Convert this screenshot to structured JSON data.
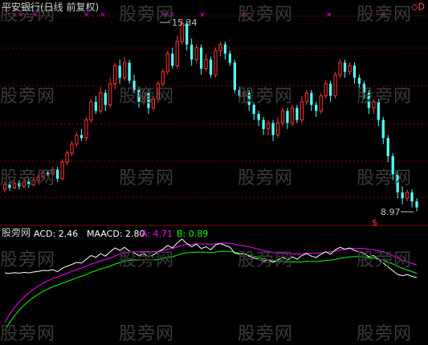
{
  "title": "平安银行(日线 前复权)",
  "top_right_markers": "◇D",
  "price_high_label": "15.34",
  "price_low_label": "8.97",
  "dollar_marker": "$",
  "indicator": {
    "name": "股旁网",
    "acd": "ACD: 2.46",
    "maacd": "MAACD: 2.80",
    "a": "A: 4.71",
    "b": "B: 0.89"
  },
  "watermark_text": "股旁网",
  "colors": {
    "bg": "#000000",
    "up": "#ff3232",
    "down": "#54ffff",
    "grid": "#8b0000",
    "text": "#c0c0c0",
    "title": "#d0d0d0",
    "line_white": "#ffffff",
    "line_magenta": "#ff00ff",
    "line_green": "#00ff00",
    "marker": "#ff00ff"
  },
  "chart_data": {
    "type": "candlestick",
    "price_range": [
      8.9,
      15.34
    ],
    "high": 15.34,
    "low": 8.97,
    "candles": [
      {
        "o": 9.7,
        "c": 9.85,
        "h": 9.95,
        "l": 9.6
      },
      {
        "o": 9.85,
        "c": 9.75,
        "h": 9.95,
        "l": 9.65
      },
      {
        "o": 9.75,
        "c": 9.9,
        "h": 10.0,
        "l": 9.7
      },
      {
        "o": 9.9,
        "c": 9.8,
        "h": 10.0,
        "l": 9.7
      },
      {
        "o": 9.8,
        "c": 9.95,
        "h": 10.05,
        "l": 9.75
      },
      {
        "o": 9.95,
        "c": 9.85,
        "h": 10.05,
        "l": 9.75
      },
      {
        "o": 9.85,
        "c": 10.0,
        "h": 10.1,
        "l": 9.8
      },
      {
        "o": 10.0,
        "c": 10.1,
        "h": 10.2,
        "l": 9.9
      },
      {
        "o": 10.1,
        "c": 10.25,
        "h": 10.35,
        "l": 10.0
      },
      {
        "o": 10.25,
        "c": 10.2,
        "h": 10.35,
        "l": 10.1
      },
      {
        "o": 10.2,
        "c": 10.35,
        "h": 10.45,
        "l": 10.15
      },
      {
        "o": 10.35,
        "c": 10.05,
        "h": 10.45,
        "l": 9.95
      },
      {
        "o": 10.05,
        "c": 10.6,
        "h": 10.7,
        "l": 10.0
      },
      {
        "o": 10.6,
        "c": 10.9,
        "h": 11.0,
        "l": 10.5
      },
      {
        "o": 10.9,
        "c": 11.2,
        "h": 11.3,
        "l": 10.8
      },
      {
        "o": 11.2,
        "c": 11.5,
        "h": 11.6,
        "l": 11.1
      },
      {
        "o": 11.5,
        "c": 11.4,
        "h": 11.7,
        "l": 11.3
      },
      {
        "o": 11.4,
        "c": 12.0,
        "h": 12.1,
        "l": 11.3
      },
      {
        "o": 12.0,
        "c": 12.6,
        "h": 12.7,
        "l": 11.9
      },
      {
        "o": 12.6,
        "c": 12.3,
        "h": 12.8,
        "l": 12.2
      },
      {
        "o": 12.3,
        "c": 12.9,
        "h": 13.1,
        "l": 12.2
      },
      {
        "o": 12.9,
        "c": 12.5,
        "h": 13.0,
        "l": 12.3
      },
      {
        "o": 12.5,
        "c": 13.2,
        "h": 13.4,
        "l": 12.4
      },
      {
        "o": 13.2,
        "c": 13.8,
        "h": 13.9,
        "l": 13.0
      },
      {
        "o": 13.8,
        "c": 13.4,
        "h": 14.0,
        "l": 13.2
      },
      {
        "o": 13.4,
        "c": 13.9,
        "h": 14.1,
        "l": 13.3
      },
      {
        "o": 13.9,
        "c": 13.3,
        "h": 14.0,
        "l": 13.2
      },
      {
        "o": 13.3,
        "c": 13.0,
        "h": 13.5,
        "l": 12.9
      },
      {
        "o": 13.0,
        "c": 12.6,
        "h": 13.1,
        "l": 12.4
      },
      {
        "o": 12.6,
        "c": 12.9,
        "h": 13.0,
        "l": 12.5
      },
      {
        "o": 12.9,
        "c": 12.4,
        "h": 13.0,
        "l": 12.2
      },
      {
        "o": 12.4,
        "c": 12.7,
        "h": 12.8,
        "l": 12.3
      },
      {
        "o": 12.7,
        "c": 13.2,
        "h": 13.3,
        "l": 12.6
      },
      {
        "o": 13.2,
        "c": 13.6,
        "h": 13.7,
        "l": 13.1
      },
      {
        "o": 13.6,
        "c": 14.2,
        "h": 14.3,
        "l": 13.5
      },
      {
        "o": 14.2,
        "c": 13.8,
        "h": 14.4,
        "l": 13.7
      },
      {
        "o": 13.8,
        "c": 14.6,
        "h": 14.8,
        "l": 13.7
      },
      {
        "o": 14.6,
        "c": 15.2,
        "h": 15.34,
        "l": 14.5
      },
      {
        "o": 15.2,
        "c": 14.5,
        "h": 15.3,
        "l": 14.3
      },
      {
        "o": 14.5,
        "c": 14.0,
        "h": 14.7,
        "l": 13.8
      },
      {
        "o": 14.0,
        "c": 14.4,
        "h": 14.5,
        "l": 13.9
      },
      {
        "o": 14.4,
        "c": 13.7,
        "h": 14.5,
        "l": 13.5
      },
      {
        "o": 13.7,
        "c": 14.0,
        "h": 14.2,
        "l": 13.6
      },
      {
        "o": 14.0,
        "c": 13.5,
        "h": 14.1,
        "l": 13.4
      },
      {
        "o": 13.5,
        "c": 14.3,
        "h": 14.4,
        "l": 13.4
      },
      {
        "o": 14.3,
        "c": 14.5,
        "h": 14.6,
        "l": 14.1
      },
      {
        "o": 14.5,
        "c": 14.2,
        "h": 14.6,
        "l": 14.0
      },
      {
        "o": 14.2,
        "c": 13.9,
        "h": 14.3,
        "l": 13.8
      },
      {
        "o": 13.9,
        "c": 13.0,
        "h": 14.0,
        "l": 12.9
      },
      {
        "o": 13.0,
        "c": 12.8,
        "h": 13.1,
        "l": 12.6
      },
      {
        "o": 12.8,
        "c": 12.9,
        "h": 13.0,
        "l": 12.6
      },
      {
        "o": 12.9,
        "c": 12.5,
        "h": 13.0,
        "l": 12.3
      },
      {
        "o": 12.5,
        "c": 12.2,
        "h": 12.6,
        "l": 12.0
      },
      {
        "o": 12.2,
        "c": 12.0,
        "h": 12.3,
        "l": 11.8
      },
      {
        "o": 12.0,
        "c": 11.7,
        "h": 12.1,
        "l": 11.5
      },
      {
        "o": 11.7,
        "c": 11.9,
        "h": 12.0,
        "l": 11.5
      },
      {
        "o": 11.9,
        "c": 11.5,
        "h": 12.0,
        "l": 11.3
      },
      {
        "o": 11.5,
        "c": 11.9,
        "h": 12.1,
        "l": 11.4
      },
      {
        "o": 11.9,
        "c": 12.3,
        "h": 12.4,
        "l": 11.8
      },
      {
        "o": 12.3,
        "c": 11.9,
        "h": 12.4,
        "l": 11.7
      },
      {
        "o": 11.9,
        "c": 12.4,
        "h": 12.5,
        "l": 11.8
      },
      {
        "o": 12.4,
        "c": 12.0,
        "h": 12.5,
        "l": 11.9
      },
      {
        "o": 12.0,
        "c": 12.6,
        "h": 12.8,
        "l": 11.9
      },
      {
        "o": 12.6,
        "c": 12.9,
        "h": 13.0,
        "l": 12.5
      },
      {
        "o": 12.9,
        "c": 12.5,
        "h": 13.0,
        "l": 12.3
      },
      {
        "o": 12.5,
        "c": 12.3,
        "h": 12.6,
        "l": 12.1
      },
      {
        "o": 12.3,
        "c": 12.8,
        "h": 12.9,
        "l": 12.2
      },
      {
        "o": 12.8,
        "c": 13.2,
        "h": 13.3,
        "l": 12.7
      },
      {
        "o": 13.2,
        "c": 12.8,
        "h": 13.3,
        "l": 12.6
      },
      {
        "o": 12.8,
        "c": 13.5,
        "h": 13.6,
        "l": 12.7
      },
      {
        "o": 13.5,
        "c": 13.9,
        "h": 14.0,
        "l": 13.4
      },
      {
        "o": 13.9,
        "c": 13.6,
        "h": 14.0,
        "l": 13.4
      },
      {
        "o": 13.6,
        "c": 13.8,
        "h": 13.9,
        "l": 13.5
      },
      {
        "o": 13.8,
        "c": 13.4,
        "h": 13.9,
        "l": 13.2
      },
      {
        "o": 13.4,
        "c": 13.2,
        "h": 13.5,
        "l": 13.0
      },
      {
        "o": 13.2,
        "c": 12.9,
        "h": 13.3,
        "l": 12.7
      },
      {
        "o": 12.9,
        "c": 12.4,
        "h": 13.0,
        "l": 12.2
      },
      {
        "o": 12.4,
        "c": 12.6,
        "h": 12.7,
        "l": 12.2
      },
      {
        "o": 12.6,
        "c": 12.0,
        "h": 12.7,
        "l": 11.8
      },
      {
        "o": 12.0,
        "c": 11.4,
        "h": 12.1,
        "l": 11.2
      },
      {
        "o": 11.4,
        "c": 10.8,
        "h": 11.5,
        "l": 10.6
      },
      {
        "o": 10.8,
        "c": 10.2,
        "h": 10.9,
        "l": 10.0
      },
      {
        "o": 10.2,
        "c": 9.6,
        "h": 10.3,
        "l": 9.4
      },
      {
        "o": 9.6,
        "c": 9.4,
        "h": 9.8,
        "l": 9.2
      },
      {
        "o": 9.4,
        "c": 9.6,
        "h": 9.7,
        "l": 9.3
      },
      {
        "o": 9.6,
        "c": 9.3,
        "h": 9.7,
        "l": 9.1
      },
      {
        "o": 9.3,
        "c": 9.1,
        "h": 9.4,
        "l": 8.97
      }
    ]
  }
}
